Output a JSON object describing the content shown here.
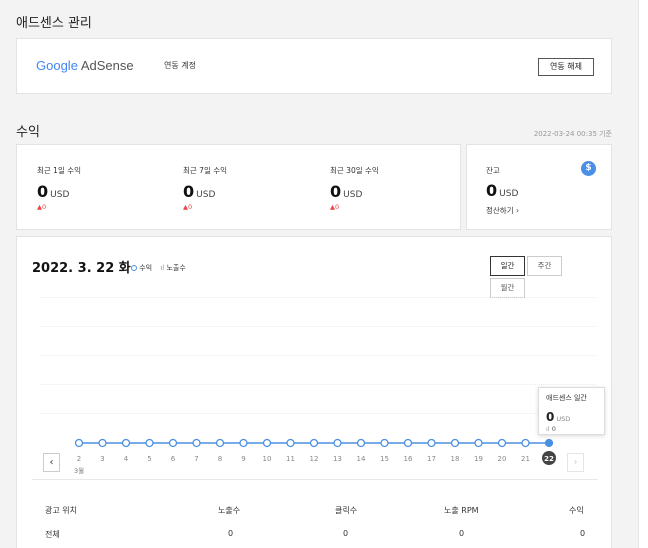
{
  "adsense": {
    "title": "애드센스 관리",
    "logo_google": "Google",
    "logo_adsense": "AdSense",
    "linked_account_label": "연동 계정",
    "unlink_button": "연동 해제"
  },
  "revenue": {
    "title": "수익",
    "timestamp": "2022-03-24 00:35 기준",
    "stats": [
      {
        "label": "최근 1일 수익",
        "value": "0",
        "unit": "USD",
        "change": "▲0"
      },
      {
        "label": "최근 7일 수익",
        "value": "0",
        "unit": "USD",
        "change": "▲0"
      },
      {
        "label": "최근 30일 수익",
        "value": "0",
        "unit": "USD",
        "change": "▲0"
      }
    ],
    "balance": {
      "label": "잔고",
      "value": "0",
      "unit": "USD",
      "settle_link": "정산하기 ›",
      "icon": "dollar-icon"
    }
  },
  "chart": {
    "date": "2022. 3. 22 화",
    "legend_revenue": "수익",
    "legend_impressions": "노출수",
    "period_tabs": {
      "daily": "일간",
      "weekly": "주간",
      "monthly": "월간",
      "active": "daily"
    },
    "tooltip": {
      "title": "애드센스 일간",
      "value": "0",
      "unit": "USD",
      "sub": "0"
    },
    "month_label": "3월",
    "colors": {
      "line": "#4a90e2",
      "dot": "#4a90e2",
      "selected": "#444444"
    }
  },
  "chart_data": {
    "type": "line",
    "x": [
      "2",
      "3",
      "4",
      "5",
      "6",
      "7",
      "8",
      "9",
      "10",
      "11",
      "12",
      "13",
      "14",
      "15",
      "16",
      "17",
      "18",
      "19",
      "20",
      "21",
      "22"
    ],
    "series": [
      {
        "name": "수익",
        "values": [
          0,
          0,
          0,
          0,
          0,
          0,
          0,
          0,
          0,
          0,
          0,
          0,
          0,
          0,
          0,
          0,
          0,
          0,
          0,
          0,
          0
        ]
      }
    ],
    "selected": "22"
  },
  "table": {
    "headers": [
      "광고 위치",
      "노출수",
      "클릭수",
      "노출 RPM",
      "수익"
    ],
    "rows": [
      [
        "전체",
        "0",
        "0",
        "0",
        "0"
      ]
    ]
  }
}
